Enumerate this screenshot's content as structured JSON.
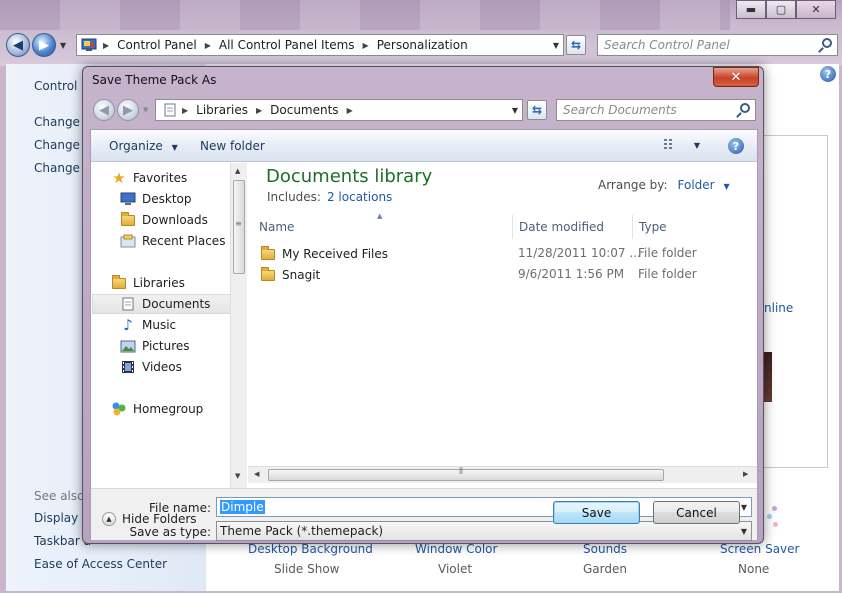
{
  "window": {
    "caption_min": "▬",
    "caption_max": "▢",
    "caption_close": "✕",
    "breadcrumbs": [
      "Control Panel",
      "All Control Panel Items",
      "Personalization"
    ],
    "search_placeholder": "Search Control Panel",
    "left_links": {
      "control_panel_home": "Control P",
      "change_1": "Change c",
      "change_2": "Change r",
      "change_3": "Change y",
      "see_also": "See also",
      "display": "Display",
      "taskbar": "Taskbar a",
      "ease": "Ease of Access Center"
    },
    "right_fragment": "nline",
    "bottom_items": [
      {
        "label": "Desktop Background",
        "value": "Slide Show"
      },
      {
        "label": "Window Color",
        "value": "Violet"
      },
      {
        "label": "Sounds",
        "value": "Garden"
      },
      {
        "label": "Screen Saver",
        "value": "None"
      }
    ]
  },
  "dialog": {
    "title": "Save Theme Pack As",
    "breadcrumbs": [
      "Libraries",
      "Documents"
    ],
    "search_placeholder": "Search Documents",
    "toolbar": {
      "organize": "Organize",
      "new_folder": "New folder"
    },
    "nav": {
      "favorites": "Favorites",
      "desktop": "Desktop",
      "downloads": "Downloads",
      "recent_places": "Recent Places",
      "libraries": "Libraries",
      "documents": "Documents",
      "music": "Music",
      "pictures": "Pictures",
      "videos": "Videos",
      "homegroup": "Homegroup"
    },
    "library": {
      "title": "Documents library",
      "includes_label": "Includes:",
      "includes_link": "2 locations",
      "arrange_label": "Arrange by:",
      "arrange_value": "Folder"
    },
    "columns": {
      "name": "Name",
      "date": "Date modified",
      "type": "Type"
    },
    "files": [
      {
        "name": "My Received Files",
        "date": "11/28/2011 10:07 ...",
        "type": "File folder"
      },
      {
        "name": "Snagit",
        "date": "9/6/2011 1:56 PM",
        "type": "File folder"
      }
    ],
    "file_name_label": "File name:",
    "file_name_value": "Dimple",
    "save_type_label": "Save as type:",
    "save_type_value": "Theme Pack (*.themepack)",
    "hide_folders": "Hide Folders",
    "save": "Save",
    "cancel": "Cancel",
    "help": "?"
  }
}
